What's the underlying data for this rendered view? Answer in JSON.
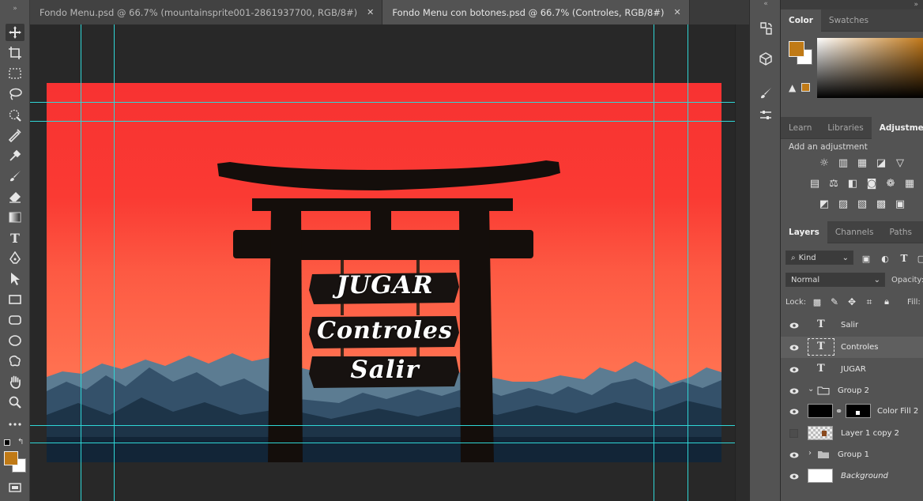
{
  "tabs": [
    {
      "label": "Fondo Menu.psd @ 66.7% (mountainsprite001-2861937700, RGB/8#)",
      "close": "✕",
      "active": false
    },
    {
      "label": "Fondo Menu con botones.psd @ 66.7% (Controles, RGB/8#)",
      "close": "✕",
      "active": true
    }
  ],
  "canvas": {
    "signs": [
      "JUGAR",
      "Controles",
      "Salir"
    ],
    "colors": {
      "sky_top": "#f83232",
      "sky_bottom": "#ff7654",
      "torii": "#140e0b",
      "mountain_dark": "#1d3448",
      "mountain_light": "#5c7c92",
      "guide": "#2fd6d6"
    }
  },
  "color_panel": {
    "tabs": [
      "Color",
      "Swatches"
    ],
    "foreground": "#c07a16",
    "background": "#ffffff"
  },
  "adjustments_panel": {
    "tabs": [
      "Learn",
      "Libraries",
      "Adjustments"
    ],
    "title": "Add an adjustment"
  },
  "layers_panel": {
    "tabs": [
      "Layers",
      "Channels",
      "Paths"
    ],
    "filter_kind": "Kind",
    "blend_mode": "Normal",
    "opacity_label": "Opacity:",
    "lock_label": "Lock:",
    "fill_label": "Fill:",
    "layers": [
      {
        "name": "Salir",
        "type": "text",
        "visible": true
      },
      {
        "name": "Controles",
        "type": "text",
        "visible": true,
        "selected": true
      },
      {
        "name": "JUGAR",
        "type": "text",
        "visible": true
      },
      {
        "name": "Group 2",
        "type": "group",
        "visible": true,
        "expanded": true
      },
      {
        "name": "Color Fill 2",
        "type": "fill",
        "visible": true
      },
      {
        "name": "Layer 1 copy 2",
        "type": "pixel",
        "visible": false
      },
      {
        "name": "Group 1",
        "type": "group",
        "visible": true,
        "expanded": false
      },
      {
        "name": "Background",
        "type": "background",
        "visible": true
      }
    ]
  }
}
